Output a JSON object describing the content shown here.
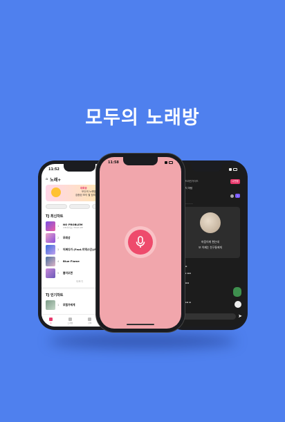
{
  "headline": "모두의 노래방",
  "left_phone": {
    "time": "11:52",
    "logo": "노래+",
    "banner": {
      "badge": "대회중",
      "text": "모두의 노래방기\n검증된 보이 팔 참여중입니다"
    },
    "section_latest": "TJ 최신차트",
    "latest": [
      {
        "title": "NO PROBLEM",
        "sub": "IVE(아이브) TEAM LEE",
        "color": "#7b4ee0"
      },
      {
        "title": "모래성",
        "sub": "",
        "color": "#e9a4c8"
      },
      {
        "title": "어쩌다가 (Feat.이엑스인)(Prod.",
        "sub": "",
        "color": "#3a6bd8"
      },
      {
        "title": "Blue Flame",
        "sub": "",
        "color": "#4b6fa0"
      },
      {
        "title": "봄이오면",
        "sub": "",
        "color": "#c989d9"
      }
    ],
    "more": "더보기",
    "section_popular": "TJ 인기차트",
    "popular": [
      {
        "title": "모험가에게",
        "sub": "",
        "color": "#7a9a86"
      },
      {
        "title": "",
        "sub": "",
        "color": "#c44a4a"
      }
    ],
    "tabs": [
      "홈",
      "노래방",
      "검색",
      "마이"
    ]
  },
  "center_phone": {
    "time": "11:58"
  },
  "right_phone": {
    "title": "가이드라인가이드",
    "badge": "나만듣",
    "subtitle": "뭘듣지 마탐",
    "card_line1": "마음이게 편는데",
    "card_line2": "또 이제는 친구들에게",
    "chat": [
      "",
      "",
      "",
      ""
    ]
  },
  "colors": {
    "background": "#4f80ee",
    "center_screen": "#f1a6ac",
    "mic": "#ee4b6c",
    "accent": "#e8396c"
  }
}
